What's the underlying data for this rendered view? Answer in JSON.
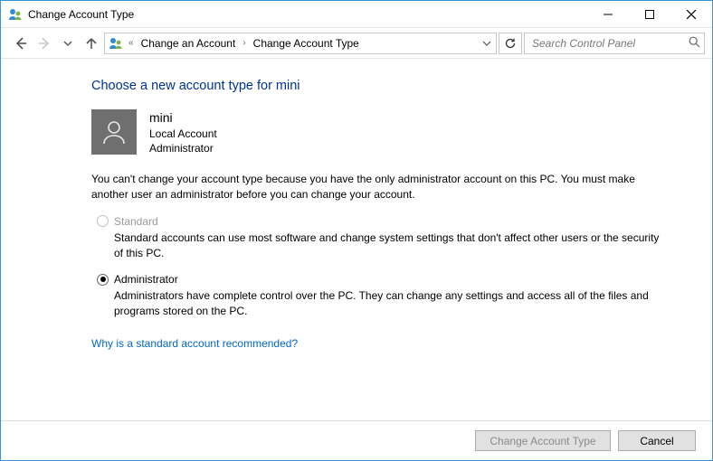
{
  "window": {
    "title": "Change Account Type"
  },
  "breadcrumb": {
    "segments": [
      "Change an Account",
      "Change Account Type"
    ]
  },
  "search": {
    "placeholder": "Search Control Panel"
  },
  "heading": "Choose a new account type for mini",
  "user": {
    "name": "mini",
    "account_kind": "Local Account",
    "role": "Administrator"
  },
  "explanation": "You can't change your account type because you have the only administrator account on this PC. You must make another user an administrator before you can change your account.",
  "options": {
    "standard": {
      "label": "Standard",
      "description": "Standard accounts can use most software and change system settings that don't affect other users or the security of this PC.",
      "selected": false,
      "enabled": false
    },
    "administrator": {
      "label": "Administrator",
      "description": "Administrators have complete control over the PC. They can change any settings and access all of the files and programs stored on the PC.",
      "selected": true,
      "enabled": true
    }
  },
  "help_link": "Why is a standard account recommended?",
  "buttons": {
    "primary": "Change Account Type",
    "cancel": "Cancel"
  }
}
